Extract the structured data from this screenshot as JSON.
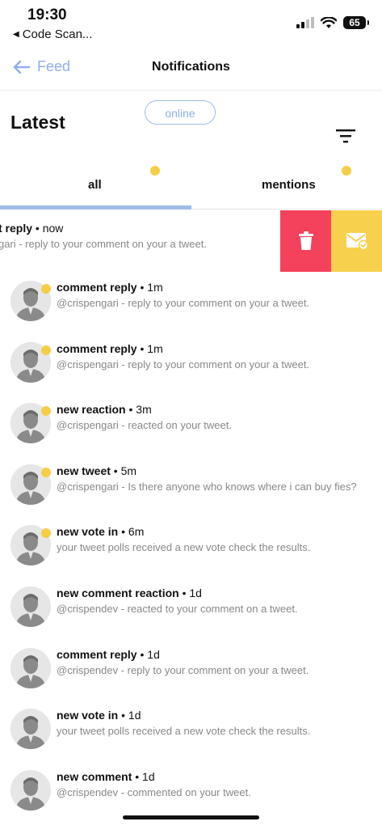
{
  "status_bar": {
    "time": "19:30",
    "back_app": "Code Scan...",
    "battery": "65"
  },
  "header": {
    "back_label": "Feed",
    "title": "Notifications"
  },
  "status_pill": "online",
  "section_title": "Latest",
  "tabs": [
    {
      "label": "all",
      "active": true
    },
    {
      "label": "mentions",
      "active": false
    }
  ],
  "swiped_item": {
    "title_visible": "t reply",
    "time": "now",
    "text_visible": "gari - reply to your comment on your a tweet.",
    "actions": [
      "delete-icon",
      "mark-read-icon"
    ]
  },
  "notifications": [
    {
      "title": "comment reply",
      "time": "1m",
      "text": "@crispengari - reply to your comment on your a tweet.",
      "unread": true
    },
    {
      "title": "comment reply",
      "time": "1m",
      "text": "@crispengari - reply to your comment on your a tweet.",
      "unread": true
    },
    {
      "title": "new reaction",
      "time": "3m",
      "text": "@crispengari - reacted on your tweet.",
      "unread": true
    },
    {
      "title": "new tweet",
      "time": "5m",
      "text": "@crispengari - Is there anyone who knows where i can buy fies?",
      "unread": true
    },
    {
      "title": "new vote in",
      "time": "6m",
      "text": "your tweet polls received a new vote check the results.",
      "unread": true
    },
    {
      "title": "new comment reaction",
      "time": "1d",
      "text": "@crispendev - reacted to your comment on a tweet.",
      "unread": false
    },
    {
      "title": "comment reply",
      "time": "1d",
      "text": "@crispendev - reply to your comment on your a tweet.",
      "unread": false
    },
    {
      "title": "new vote in",
      "time": "1d",
      "text": "your tweet polls received a new vote check the results.",
      "unread": false
    },
    {
      "title": "new comment",
      "time": "1d",
      "text": "@crispendev - commented on your tweet.",
      "unread": false
    }
  ],
  "colors": {
    "accent": "#9fbbe7",
    "unread_dot": "#f5cd47",
    "delete": "#f4415c",
    "mark_read": "#f7d04e"
  }
}
